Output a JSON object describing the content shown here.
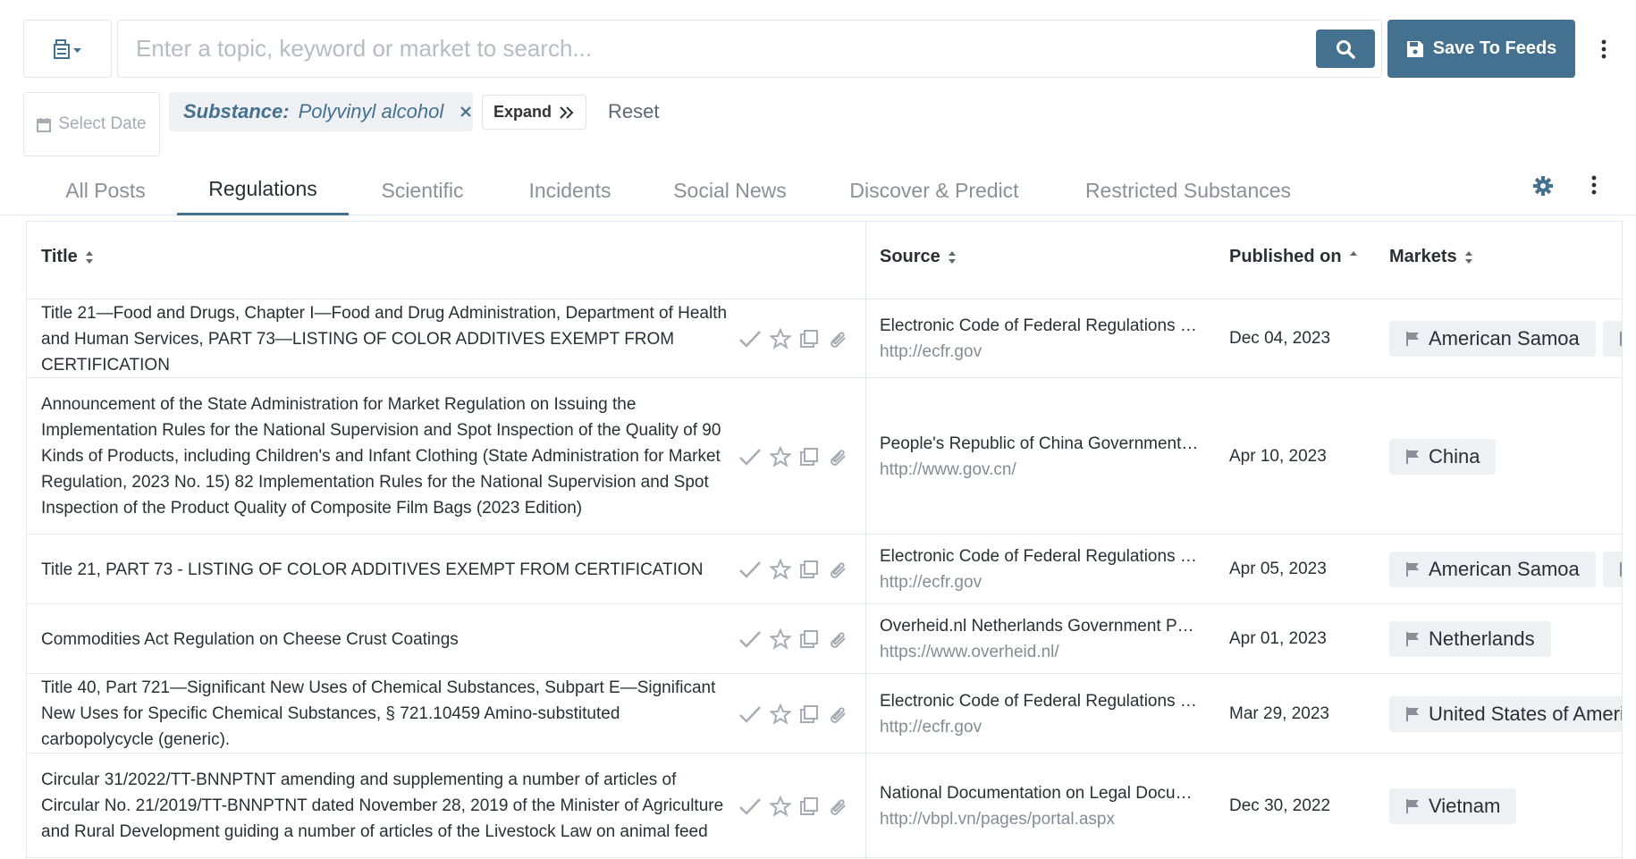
{
  "search": {
    "placeholder": "Enter a topic, keyword or market to search...",
    "save_label": "Save To Feeds"
  },
  "filters": {
    "date_label": "Select Date",
    "chip_key": "Substance:",
    "chip_value": "Polyvinyl alcohol",
    "expand_label": "Expand",
    "reset_label": "Reset"
  },
  "tabs": [
    {
      "label": "All Posts"
    },
    {
      "label": "Regulations"
    },
    {
      "label": "Scientific"
    },
    {
      "label": "Incidents"
    },
    {
      "label": "Social News"
    },
    {
      "label": "Discover & Predict"
    },
    {
      "label": "Restricted Substances"
    }
  ],
  "table": {
    "columns": {
      "title": "Title",
      "source": "Source",
      "published": "Published on",
      "markets": "Markets"
    },
    "rows": [
      {
        "title": "Title 21—Food and Drugs, Chapter I—Food and Drug Administration, Department of Health and Human Services, PART 73—LISTING OF COLOR ADDITIVES EXEMPT FROM CERTIFICATION",
        "source": "Electronic Code of Federal Regulations (eCFR)",
        "url": "http://ecfr.gov",
        "date": "Dec 04, 2023",
        "markets": [
          "American Samoa",
          ""
        ]
      },
      {
        "title": "Announcement of the State Administration for Market Regulation on Issuing the Implementation Rules for the National Supervision and Spot Inspection of the Quality of 90 Kinds of Products, including Children's and Infant Clothing (State Administration for Market Regulation, 2023 No. 15) 82 Implementation Rules for the National Supervision and Spot Inspection of the Product Quality of Composite Film Bags (2023 Edition)",
        "source": "People's Republic of China Government Website",
        "url": "http://www.gov.cn/",
        "date": "Apr 10, 2023",
        "markets": [
          "China"
        ]
      },
      {
        "title": "Title 21, PART 73 - LISTING OF COLOR ADDITIVES EXEMPT FROM CERTIFICATION",
        "source": "Electronic Code of Federal Regulations (eCFR)",
        "url": "http://ecfr.gov",
        "date": "Apr 05, 2023",
        "markets": [
          "American Samoa",
          ""
        ]
      },
      {
        "title": "Commodities Act Regulation on Cheese Crust Coatings",
        "source": "Overheid.nl Netherlands Government Portal",
        "url": "https://www.overheid.nl/",
        "date": "Apr 01, 2023",
        "markets": [
          "Netherlands"
        ]
      },
      {
        "title": "Title 40, Part 721—Significant New Uses of Chemical Substances, Subpart E—Significant New Uses for Specific Chemical Substances, § 721.10459 Amino-substituted carbopolycycle (generic).",
        "source": "Electronic Code of Federal Regulations (eCFR)",
        "url": "http://ecfr.gov",
        "date": "Mar 29, 2023",
        "markets": [
          "United States of America"
        ]
      },
      {
        "title": "Circular 31/2022/TT-BNNPTNT amending and supplementing a number of articles of Circular No. 21/2019/TT-BNNPTNT dated November 28, 2019 of the Minister of Agriculture and Rural Development guiding a number of articles of the Livestock Law on animal feed",
        "source": "National Documentation on Legal Documents",
        "url": "http://vbpl.vn/pages/portal.aspx",
        "date": "Dec 30, 2022",
        "markets": [
          "Vietnam"
        ]
      }
    ]
  },
  "colors": {
    "accent": "#44718f",
    "chip_bg": "#eef0f3",
    "muted": "#858c94"
  },
  "icons": [
    "source-selector-icon",
    "search-icon",
    "save-icon",
    "kebab-icon",
    "calendar-icon",
    "close-icon",
    "double-chevron-right-icon",
    "gear-icon",
    "check-icon",
    "star-icon",
    "copy-icon",
    "paperclip-icon",
    "flag-icon",
    "sort-icon"
  ]
}
